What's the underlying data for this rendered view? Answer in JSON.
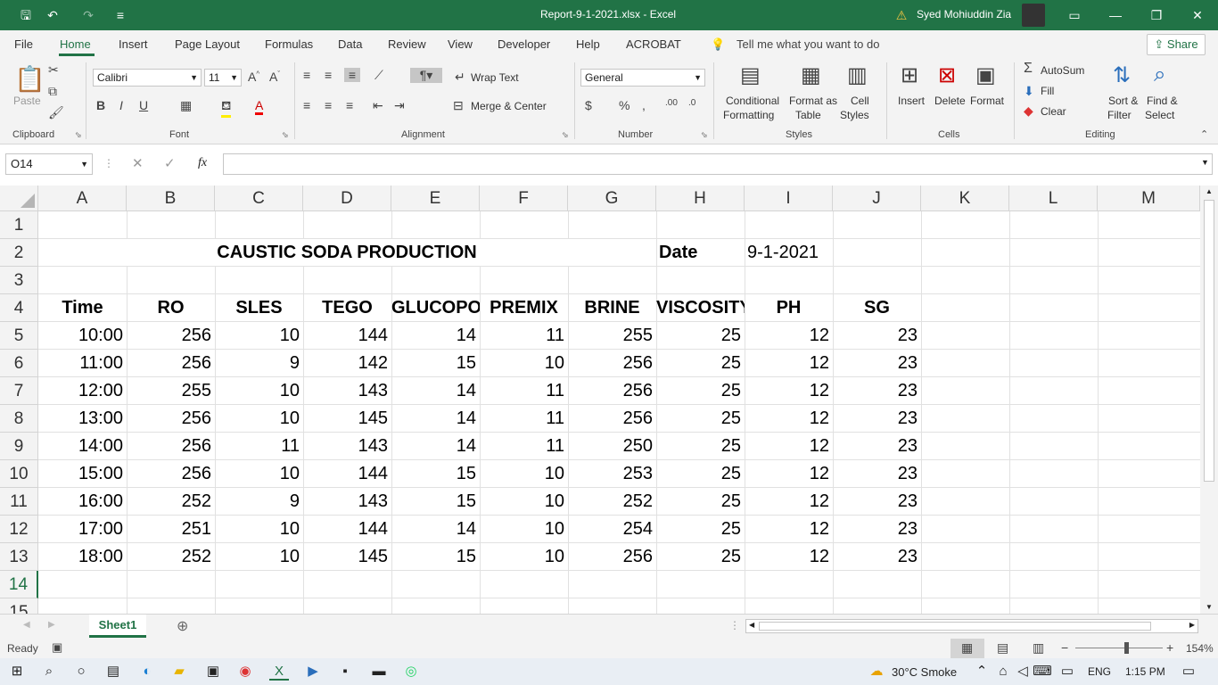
{
  "titlebar": {
    "title": "Report-9-1-2021.xlsx  -  Excel",
    "user": "Syed Mohiuddin Zia"
  },
  "menu": {
    "items": [
      "File",
      "Home",
      "Insert",
      "Page Layout",
      "Formulas",
      "Data",
      "Review",
      "View",
      "Developer",
      "Help",
      "ACROBAT"
    ],
    "tell_me": "Tell me what you want to do",
    "share": "Share"
  },
  "ribbon": {
    "clipboard": {
      "paste": "Paste",
      "label": "Clipboard"
    },
    "font": {
      "name": "Calibri",
      "size": "11",
      "label": "Font"
    },
    "alignment": {
      "wrap": "Wrap Text",
      "merge": "Merge & Center",
      "label": "Alignment"
    },
    "number": {
      "format": "General",
      "label": "Number"
    },
    "styles": {
      "conditional": "Conditional",
      "formatting": "Formatting",
      "format_as": "Format as",
      "table": "Table",
      "cell": "Cell",
      "cell_styles": "Styles",
      "label": "Styles"
    },
    "cells": {
      "insert": "Insert",
      "delete": "Delete",
      "format": "Format",
      "label": "Cells"
    },
    "editing": {
      "autosum": "AutoSum",
      "fill": "Fill",
      "clear": "Clear",
      "sort": "Sort &",
      "filter": "Filter",
      "find": "Find &",
      "select": "Select",
      "label": "Editing"
    }
  },
  "formula_bar": {
    "name_box": "O14",
    "fx": "fx",
    "value": ""
  },
  "columns": [
    "A",
    "B",
    "C",
    "D",
    "E",
    "F",
    "G",
    "H",
    "I",
    "J",
    "K",
    "L",
    "M"
  ],
  "rows": [
    "1",
    "2",
    "3",
    "4",
    "5",
    "6",
    "7",
    "8",
    "9",
    "10",
    "11",
    "12",
    "13",
    "14",
    "15"
  ],
  "sheet": {
    "title": "CAUSTIC SODA PRODUCTION",
    "date_label": "Date",
    "date_value": "9-1-2021",
    "headers": [
      "Time",
      "RO",
      "SLES",
      "TEGO",
      "GLUCOPO",
      "PREMIX",
      "BRINE",
      "VISCOSITY",
      "PH",
      "SG"
    ],
    "data": [
      [
        "10:00",
        "256",
        "10",
        "144",
        "14",
        "11",
        "255",
        "25",
        "12",
        "23"
      ],
      [
        "11:00",
        "256",
        "9",
        "142",
        "15",
        "10",
        "256",
        "25",
        "12",
        "23"
      ],
      [
        "12:00",
        "255",
        "10",
        "143",
        "14",
        "11",
        "256",
        "25",
        "12",
        "23"
      ],
      [
        "13:00",
        "256",
        "10",
        "145",
        "14",
        "11",
        "256",
        "25",
        "12",
        "23"
      ],
      [
        "14:00",
        "256",
        "11",
        "143",
        "14",
        "11",
        "250",
        "25",
        "12",
        "23"
      ],
      [
        "15:00",
        "256",
        "10",
        "144",
        "15",
        "10",
        "253",
        "25",
        "12",
        "23"
      ],
      [
        "16:00",
        "252",
        "9",
        "143",
        "15",
        "10",
        "252",
        "25",
        "12",
        "23"
      ],
      [
        "17:00",
        "251",
        "10",
        "144",
        "14",
        "10",
        "254",
        "25",
        "12",
        "23"
      ],
      [
        "18:00",
        "252",
        "10",
        "145",
        "15",
        "10",
        "256",
        "25",
        "12",
        "23"
      ]
    ]
  },
  "sheet_tab": "Sheet1",
  "status": {
    "ready": "Ready",
    "zoom": "154%"
  },
  "taskbar": {
    "weather": "30°C  Smoke",
    "lang": "ENG",
    "time": "1:15 PM"
  }
}
